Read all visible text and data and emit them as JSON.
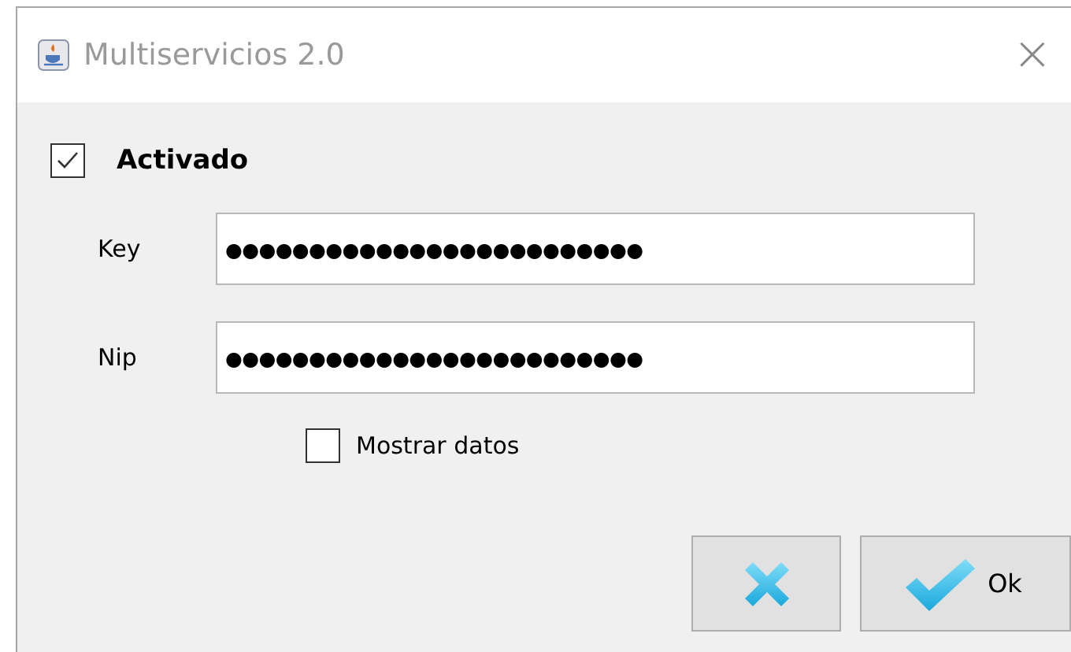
{
  "window": {
    "title": "Multiservicios 2.0",
    "close": "×"
  },
  "activado": {
    "label": "Activado",
    "checked": true
  },
  "fields": [
    {
      "label": "Key",
      "value": "●●●●●●●●●●●●●●●●●●●●●●●●●"
    },
    {
      "label": "Nip",
      "value": "●●●●●●●●●●●●●●●●●●●●●●●●●"
    }
  ],
  "mostrar_datos": {
    "label": "Mostrar datos",
    "checked": false
  },
  "buttons": [
    {
      "kind": "cancel"
    },
    {
      "kind": "ok",
      "label": "Ok"
    }
  ]
}
